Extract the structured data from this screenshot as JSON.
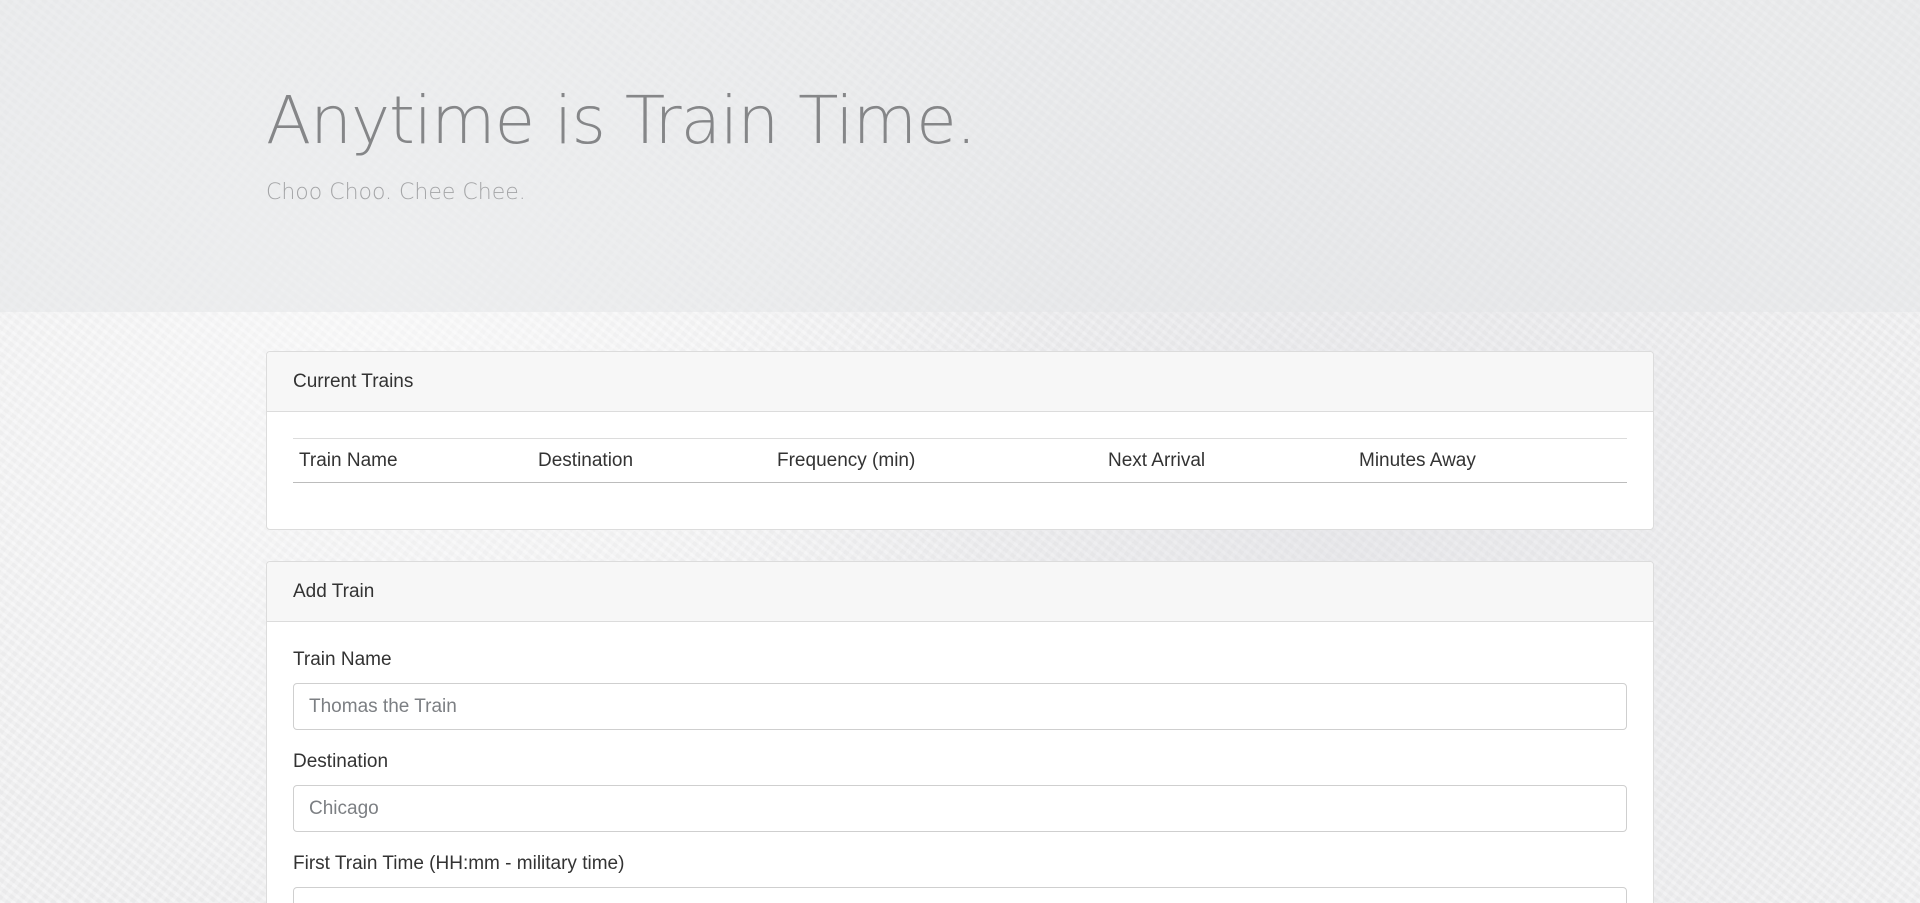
{
  "header": {
    "title": "Anytime is Train Time.",
    "subtitle": "Choo Choo. Chee Chee."
  },
  "current_trains": {
    "heading": "Current Trains",
    "columns": [
      "Train Name",
      "Destination",
      "Frequency (min)",
      "Next Arrival",
      "Minutes Away"
    ],
    "rows": []
  },
  "add_train": {
    "heading": "Add Train",
    "fields": [
      {
        "label": "Train Name",
        "placeholder": "Thomas the Train",
        "value": ""
      },
      {
        "label": "Destination",
        "placeholder": "Chicago",
        "value": ""
      },
      {
        "label": "First Train Time (HH:mm - military time)",
        "placeholder": "",
        "value": ""
      }
    ]
  }
}
